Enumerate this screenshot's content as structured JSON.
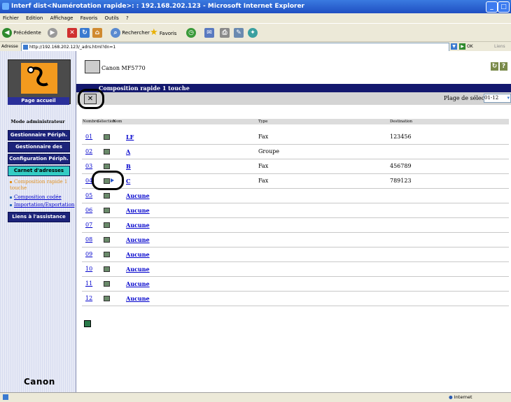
{
  "window": {
    "title": "Interf dist<Numérotation rapide>: : 192.168.202.123 - Microsoft Internet Explorer",
    "controls": [
      "_",
      "□"
    ]
  },
  "menu": [
    "Fichier",
    "Edition",
    "Affichage",
    "Favoris",
    "Outils",
    "?"
  ],
  "toolbar": {
    "back_label": "Précédente",
    "search_label": "Rechercher",
    "favorites_label": "Favoris"
  },
  "address": {
    "label": "Adresse",
    "url": "http://192.168.202.123/_adrs.html?dn=1",
    "go_label": "OK",
    "links_label": "Liens"
  },
  "sidebar": {
    "home_label": "Page accueil",
    "mode_label": "Mode administrateur",
    "nav": [
      {
        "label": "Gestionnaire Périph."
      },
      {
        "label": "Gestionnaire des travaux"
      },
      {
        "label": "Configuration Périph."
      },
      {
        "label": "Carnet d'adresses"
      }
    ],
    "sub_items": [
      {
        "label": "Composition rapide 1 touche"
      },
      {
        "label": "Composition codée"
      },
      {
        "label": "Importation/Exportation"
      }
    ],
    "support_label": "Liens à l'assistance",
    "brand": "Canon"
  },
  "header": {
    "device_name": "Canon MF5770",
    "help_icons": [
      "↻",
      "?"
    ]
  },
  "section": {
    "title": "Composition rapide 1 touche",
    "delete_label": "✕",
    "range_label": "Plage de sélection",
    "range_value": "01-12"
  },
  "table": {
    "headers": [
      "Nombre",
      "Sélection",
      "Nom",
      "Type",
      "Destination"
    ],
    "rows": [
      {
        "num": "01",
        "name": "LF",
        "type": "Fax",
        "dest": "123456"
      },
      {
        "num": "02",
        "name": "A",
        "type": "Groupe",
        "dest": ""
      },
      {
        "num": "03",
        "name": "B",
        "type": "Fax",
        "dest": "456789"
      },
      {
        "num": "04",
        "name": "C",
        "type": "Fax",
        "dest": "789123"
      },
      {
        "num": "05",
        "name": "Aucune",
        "type": "",
        "dest": ""
      },
      {
        "num": "06",
        "name": "Aucune",
        "type": "",
        "dest": ""
      },
      {
        "num": "07",
        "name": "Aucune",
        "type": "",
        "dest": ""
      },
      {
        "num": "08",
        "name": "Aucune",
        "type": "",
        "dest": ""
      },
      {
        "num": "09",
        "name": "Aucune",
        "type": "",
        "dest": ""
      },
      {
        "num": "10",
        "name": "Aucune",
        "type": "",
        "dest": ""
      },
      {
        "num": "11",
        "name": "Aucune",
        "type": "",
        "dest": ""
      },
      {
        "num": "12",
        "name": "Aucune",
        "type": "",
        "dest": ""
      }
    ]
  },
  "status": {
    "zone_label": "Internet"
  }
}
